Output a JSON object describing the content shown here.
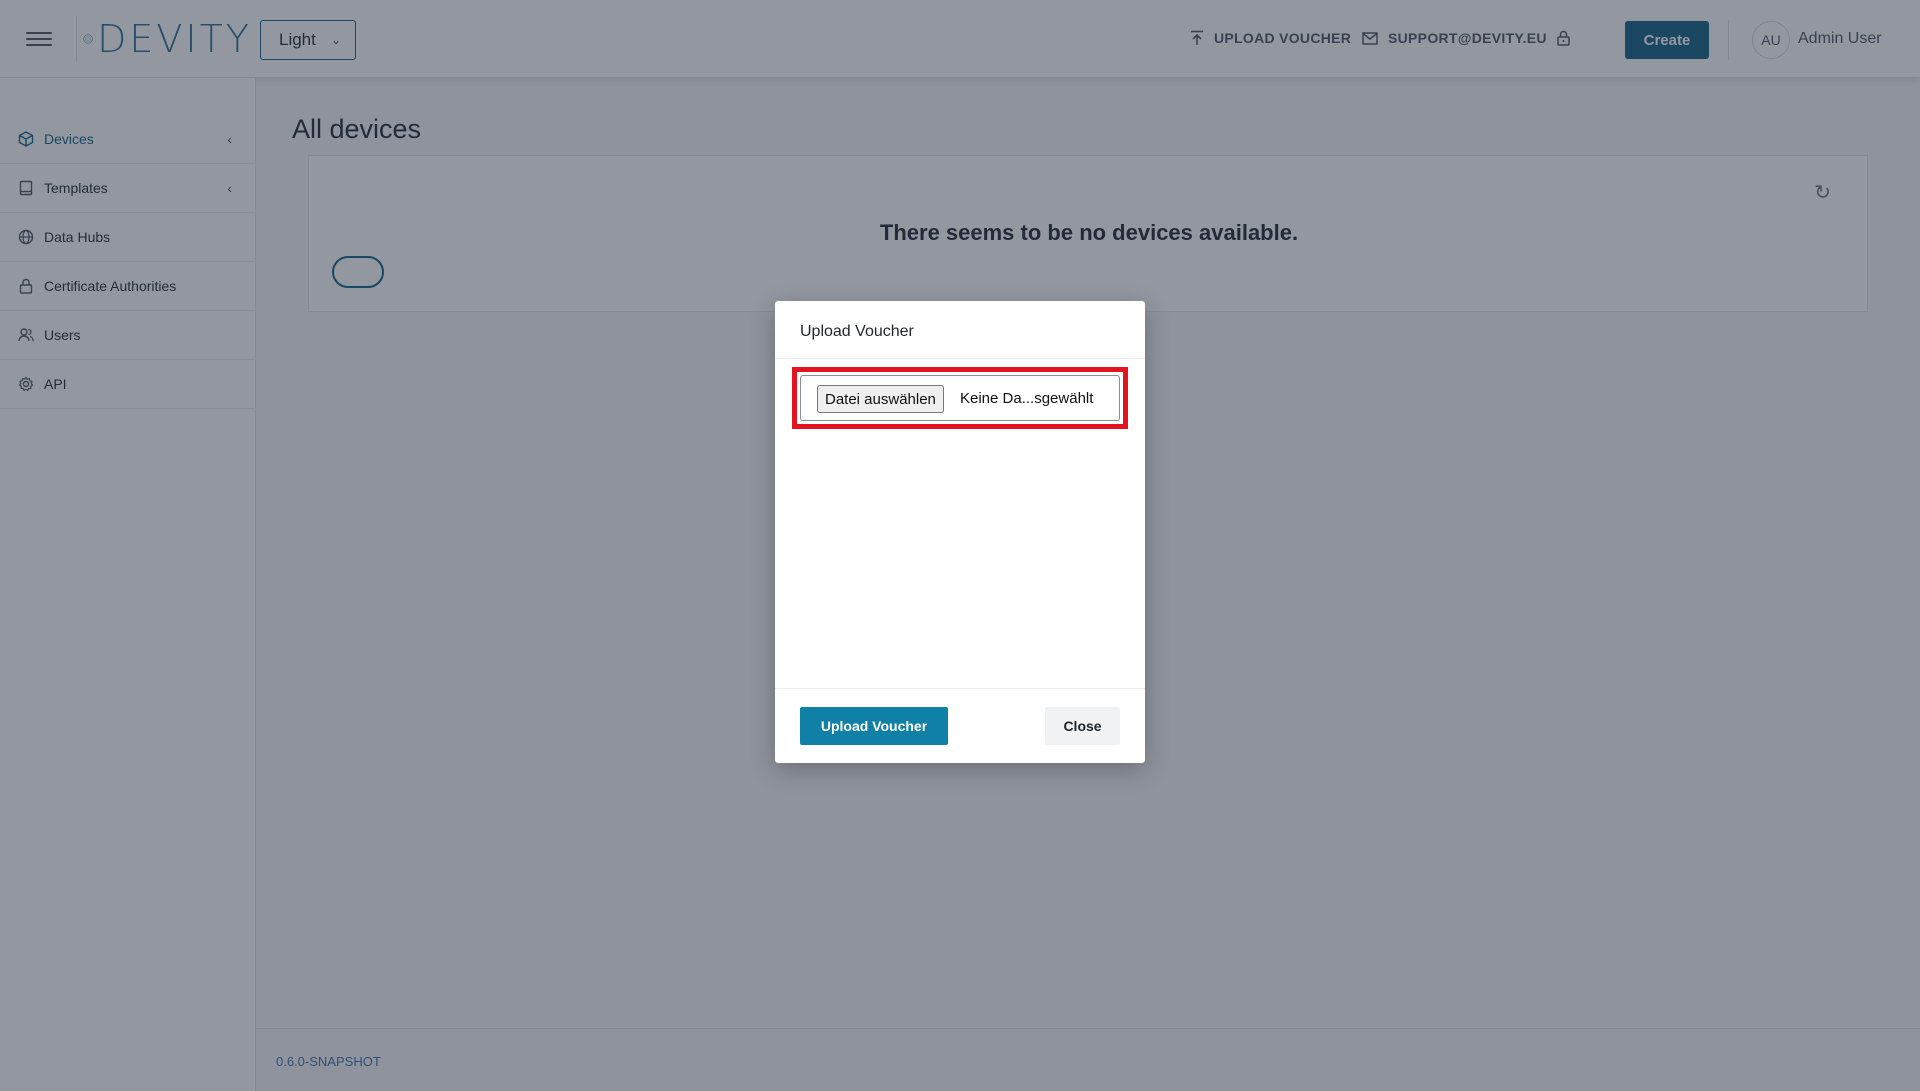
{
  "header": {
    "logo_text": "DEVITY",
    "theme_value": "Light",
    "upload_voucher_link": "UPLOAD VOUCHER",
    "support_link": "SUPPORT@DEVITY.EU",
    "create_button": "Create",
    "avatar_initials": "AU",
    "user_name": "Admin User"
  },
  "sidebar": {
    "items": [
      {
        "label": "Devices",
        "icon": "cube-icon",
        "expandable": true,
        "active": true
      },
      {
        "label": "Templates",
        "icon": "book-icon",
        "expandable": true,
        "active": false
      },
      {
        "label": "Data Hubs",
        "icon": "globe-icon",
        "expandable": false,
        "active": false
      },
      {
        "label": "Certificate Authorities",
        "icon": "lock-icon",
        "expandable": false,
        "active": false
      },
      {
        "label": "Users",
        "icon": "users-icon",
        "expandable": false,
        "active": false
      },
      {
        "label": "API",
        "icon": "gear-icon",
        "expandable": false,
        "active": false
      }
    ]
  },
  "main": {
    "page_title": "All devices",
    "empty_message": "There seems to be no devices available."
  },
  "footer": {
    "version": "0.6.0-SNAPSHOT"
  },
  "modal": {
    "title": "Upload Voucher",
    "file_button": "Datei auswählen",
    "file_status": "Keine Da...sgewählt",
    "upload_button": "Upload Voucher",
    "close_button": "Close"
  },
  "colors": {
    "primary": "#0d5f80",
    "upload_button": "#1180a6",
    "highlight_outline": "#e3141f"
  }
}
